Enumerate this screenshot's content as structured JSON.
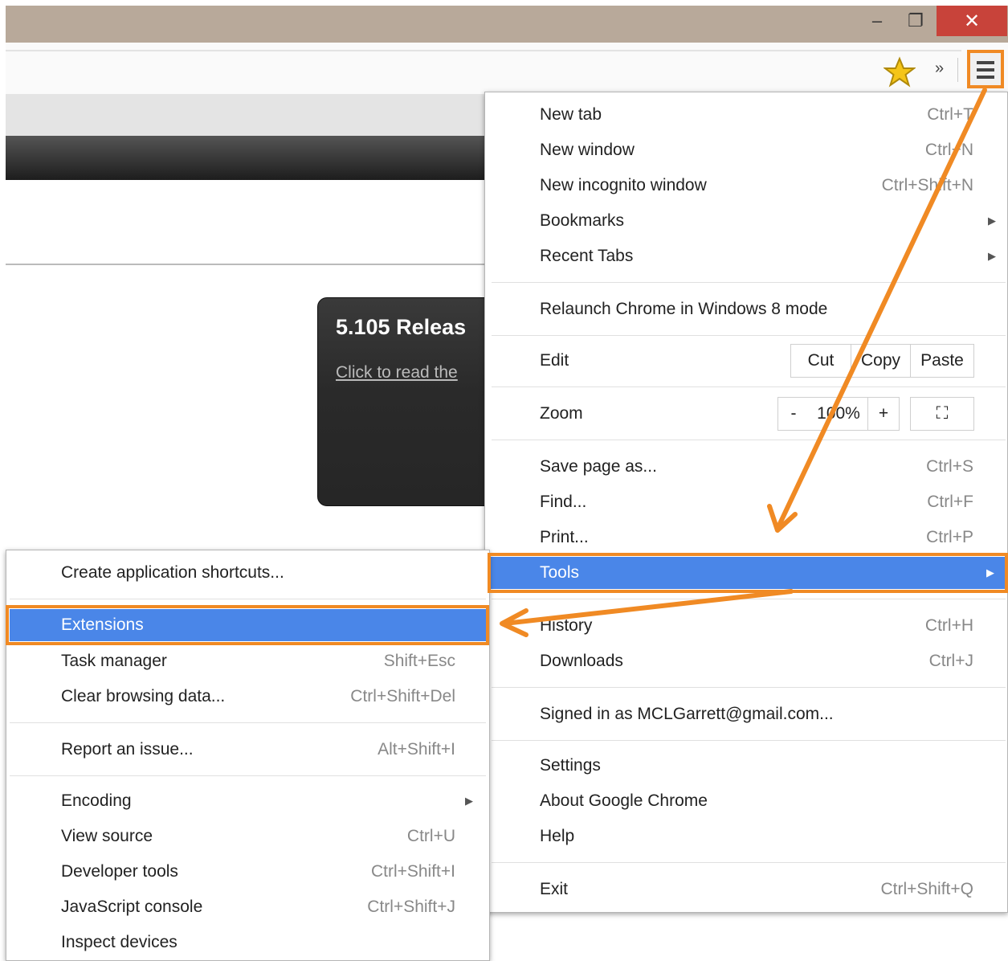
{
  "window": {
    "minimize": "–",
    "restore": "❐",
    "close": "✕"
  },
  "toolbar": {
    "star_icon": "star-icon",
    "overflow": "»"
  },
  "page": {
    "release_title": "5.105 Releas",
    "release_link": "Click to read the"
  },
  "main_menu": {
    "new_tab": {
      "label": "New tab",
      "shortcut": "Ctrl+T"
    },
    "new_window": {
      "label": "New window",
      "shortcut": "Ctrl+N"
    },
    "new_incognito": {
      "label": "New incognito window",
      "shortcut": "Ctrl+Shift+N"
    },
    "bookmarks": {
      "label": "Bookmarks"
    },
    "recent_tabs": {
      "label": "Recent Tabs"
    },
    "relaunch": {
      "label": "Relaunch Chrome in Windows 8 mode"
    },
    "edit": {
      "label": "Edit",
      "cut": "Cut",
      "copy": "Copy",
      "paste": "Paste"
    },
    "zoom": {
      "label": "Zoom",
      "minus": "-",
      "value": "100%",
      "plus": "+",
      "fullscreen": "⛶"
    },
    "save_page": {
      "label": "Save page as...",
      "shortcut": "Ctrl+S"
    },
    "find": {
      "label": "Find...",
      "shortcut": "Ctrl+F"
    },
    "print": {
      "label": "Print...",
      "shortcut": "Ctrl+P"
    },
    "tools": {
      "label": "Tools"
    },
    "history": {
      "label": "History",
      "shortcut": "Ctrl+H"
    },
    "downloads": {
      "label": "Downloads",
      "shortcut": "Ctrl+J"
    },
    "signed_in": {
      "label": "Signed in as MCLGarrett@gmail.com..."
    },
    "settings": {
      "label": "Settings"
    },
    "about": {
      "label": "About Google Chrome"
    },
    "help": {
      "label": "Help"
    },
    "exit": {
      "label": "Exit",
      "shortcut": "Ctrl+Shift+Q"
    }
  },
  "tools_menu": {
    "create_shortcuts": {
      "label": "Create application shortcuts..."
    },
    "extensions": {
      "label": "Extensions"
    },
    "task_manager": {
      "label": "Task manager",
      "shortcut": "Shift+Esc"
    },
    "clear_data": {
      "label": "Clear browsing data...",
      "shortcut": "Ctrl+Shift+Del"
    },
    "report_issue": {
      "label": "Report an issue...",
      "shortcut": "Alt+Shift+I"
    },
    "encoding": {
      "label": "Encoding"
    },
    "view_source": {
      "label": "View source",
      "shortcut": "Ctrl+U"
    },
    "dev_tools": {
      "label": "Developer tools",
      "shortcut": "Ctrl+Shift+I"
    },
    "js_console": {
      "label": "JavaScript console",
      "shortcut": "Ctrl+Shift+J"
    },
    "inspect_devices": {
      "label": "Inspect devices"
    }
  },
  "colors": {
    "highlight": "#4a86e8",
    "annotation": "#f08a24",
    "close": "#c8433a"
  }
}
